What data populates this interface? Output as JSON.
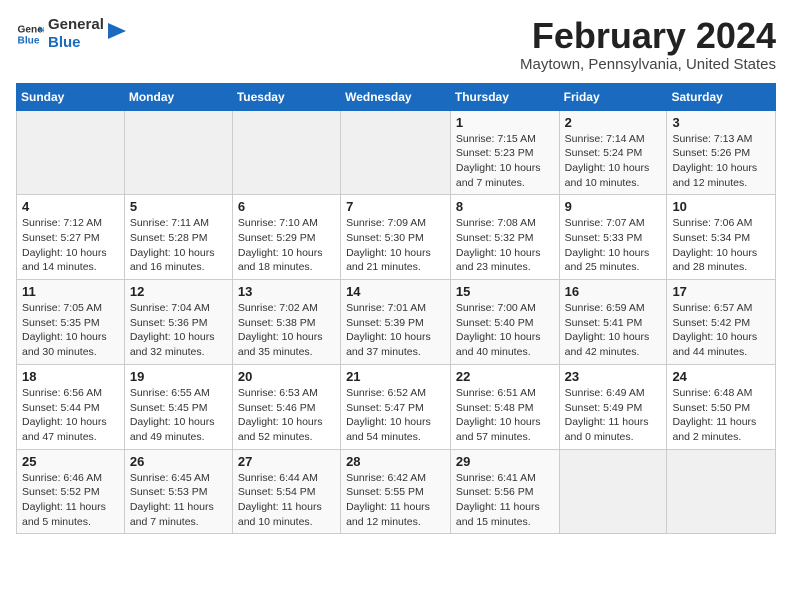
{
  "header": {
    "logo_line1": "General",
    "logo_line2": "Blue",
    "title": "February 2024",
    "subtitle": "Maytown, Pennsylvania, United States"
  },
  "weekdays": [
    "Sunday",
    "Monday",
    "Tuesday",
    "Wednesday",
    "Thursday",
    "Friday",
    "Saturday"
  ],
  "weeks": [
    [
      {
        "day": "",
        "info": ""
      },
      {
        "day": "",
        "info": ""
      },
      {
        "day": "",
        "info": ""
      },
      {
        "day": "",
        "info": ""
      },
      {
        "day": "1",
        "info": "Sunrise: 7:15 AM\nSunset: 5:23 PM\nDaylight: 10 hours\nand 7 minutes."
      },
      {
        "day": "2",
        "info": "Sunrise: 7:14 AM\nSunset: 5:24 PM\nDaylight: 10 hours\nand 10 minutes."
      },
      {
        "day": "3",
        "info": "Sunrise: 7:13 AM\nSunset: 5:26 PM\nDaylight: 10 hours\nand 12 minutes."
      }
    ],
    [
      {
        "day": "4",
        "info": "Sunrise: 7:12 AM\nSunset: 5:27 PM\nDaylight: 10 hours\nand 14 minutes."
      },
      {
        "day": "5",
        "info": "Sunrise: 7:11 AM\nSunset: 5:28 PM\nDaylight: 10 hours\nand 16 minutes."
      },
      {
        "day": "6",
        "info": "Sunrise: 7:10 AM\nSunset: 5:29 PM\nDaylight: 10 hours\nand 18 minutes."
      },
      {
        "day": "7",
        "info": "Sunrise: 7:09 AM\nSunset: 5:30 PM\nDaylight: 10 hours\nand 21 minutes."
      },
      {
        "day": "8",
        "info": "Sunrise: 7:08 AM\nSunset: 5:32 PM\nDaylight: 10 hours\nand 23 minutes."
      },
      {
        "day": "9",
        "info": "Sunrise: 7:07 AM\nSunset: 5:33 PM\nDaylight: 10 hours\nand 25 minutes."
      },
      {
        "day": "10",
        "info": "Sunrise: 7:06 AM\nSunset: 5:34 PM\nDaylight: 10 hours\nand 28 minutes."
      }
    ],
    [
      {
        "day": "11",
        "info": "Sunrise: 7:05 AM\nSunset: 5:35 PM\nDaylight: 10 hours\nand 30 minutes."
      },
      {
        "day": "12",
        "info": "Sunrise: 7:04 AM\nSunset: 5:36 PM\nDaylight: 10 hours\nand 32 minutes."
      },
      {
        "day": "13",
        "info": "Sunrise: 7:02 AM\nSunset: 5:38 PM\nDaylight: 10 hours\nand 35 minutes."
      },
      {
        "day": "14",
        "info": "Sunrise: 7:01 AM\nSunset: 5:39 PM\nDaylight: 10 hours\nand 37 minutes."
      },
      {
        "day": "15",
        "info": "Sunrise: 7:00 AM\nSunset: 5:40 PM\nDaylight: 10 hours\nand 40 minutes."
      },
      {
        "day": "16",
        "info": "Sunrise: 6:59 AM\nSunset: 5:41 PM\nDaylight: 10 hours\nand 42 minutes."
      },
      {
        "day": "17",
        "info": "Sunrise: 6:57 AM\nSunset: 5:42 PM\nDaylight: 10 hours\nand 44 minutes."
      }
    ],
    [
      {
        "day": "18",
        "info": "Sunrise: 6:56 AM\nSunset: 5:44 PM\nDaylight: 10 hours\nand 47 minutes."
      },
      {
        "day": "19",
        "info": "Sunrise: 6:55 AM\nSunset: 5:45 PM\nDaylight: 10 hours\nand 49 minutes."
      },
      {
        "day": "20",
        "info": "Sunrise: 6:53 AM\nSunset: 5:46 PM\nDaylight: 10 hours\nand 52 minutes."
      },
      {
        "day": "21",
        "info": "Sunrise: 6:52 AM\nSunset: 5:47 PM\nDaylight: 10 hours\nand 54 minutes."
      },
      {
        "day": "22",
        "info": "Sunrise: 6:51 AM\nSunset: 5:48 PM\nDaylight: 10 hours\nand 57 minutes."
      },
      {
        "day": "23",
        "info": "Sunrise: 6:49 AM\nSunset: 5:49 PM\nDaylight: 11 hours\nand 0 minutes."
      },
      {
        "day": "24",
        "info": "Sunrise: 6:48 AM\nSunset: 5:50 PM\nDaylight: 11 hours\nand 2 minutes."
      }
    ],
    [
      {
        "day": "25",
        "info": "Sunrise: 6:46 AM\nSunset: 5:52 PM\nDaylight: 11 hours\nand 5 minutes."
      },
      {
        "day": "26",
        "info": "Sunrise: 6:45 AM\nSunset: 5:53 PM\nDaylight: 11 hours\nand 7 minutes."
      },
      {
        "day": "27",
        "info": "Sunrise: 6:44 AM\nSunset: 5:54 PM\nDaylight: 11 hours\nand 10 minutes."
      },
      {
        "day": "28",
        "info": "Sunrise: 6:42 AM\nSunset: 5:55 PM\nDaylight: 11 hours\nand 12 minutes."
      },
      {
        "day": "29",
        "info": "Sunrise: 6:41 AM\nSunset: 5:56 PM\nDaylight: 11 hours\nand 15 minutes."
      },
      {
        "day": "",
        "info": ""
      },
      {
        "day": "",
        "info": ""
      }
    ]
  ]
}
